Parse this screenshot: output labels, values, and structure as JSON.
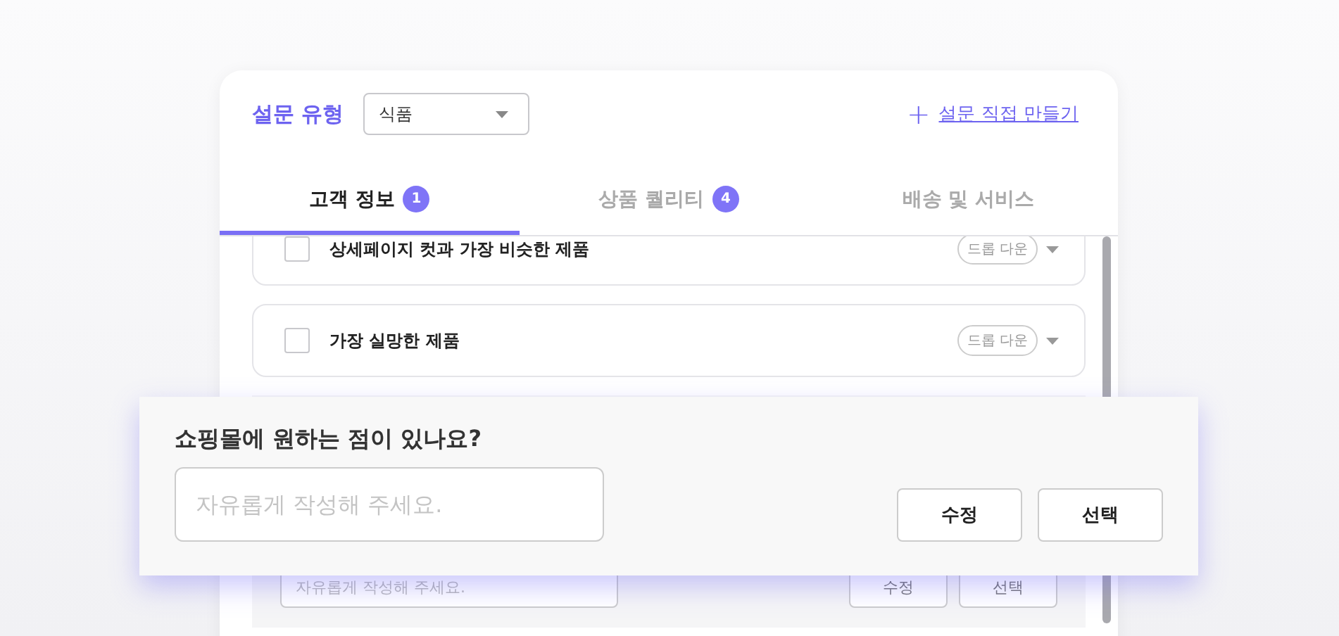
{
  "header": {
    "label": "설문 유형",
    "select": {
      "value": "식품"
    },
    "create_link": {
      "icon": "+",
      "label": "설문 직접 만들기"
    }
  },
  "tabs": [
    {
      "label": "고객 정보",
      "badge": "1",
      "selected": true
    },
    {
      "label": "상품 퀄리티",
      "badge": "4",
      "selected": false
    },
    {
      "label": "배송 및 서비스",
      "selected": false
    }
  ],
  "items": [
    {
      "label": "상세페이지 컷과 가장 비슷한 제품",
      "checked": false,
      "dropdown": "드롭 다운"
    },
    {
      "label": "가장 실망한 제품",
      "checked": false,
      "dropdown": "드롭 다운"
    }
  ],
  "background_row": {
    "placeholder": "자유롭게 작성해 주세요.",
    "buttons": [
      "수정",
      "선택"
    ]
  },
  "popup": {
    "question": "쇼핑몰에 원하는 점이 있나요?",
    "placeholder": "자유롭게 작성해 주세요.",
    "buttons": [
      "수정",
      "선택"
    ]
  }
}
